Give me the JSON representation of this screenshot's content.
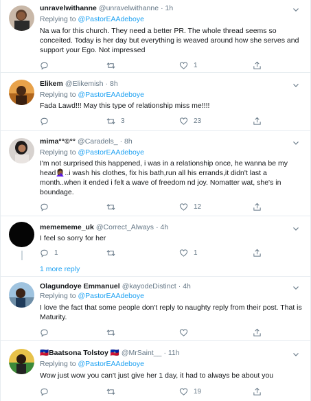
{
  "reply_prefix": "Replying to ",
  "tweets": [
    {
      "name": "unravelwithanne",
      "handle": "@unravelwithanne",
      "time": "· 1h",
      "replying_to": "@PastorEAAdeboye",
      "text": "Na wa for this church. They need a better PR. The whole thread seems so conceited. Today is her day but everything is weaved around how she serves and support your Ego. Not impressed",
      "replies": "",
      "retweets": "",
      "likes": "1"
    },
    {
      "name": "Elikem",
      "handle": "@Elikemish",
      "time": "· 8h",
      "replying_to": "@PastorEAAdeboye",
      "text": "Fada Lawd!!! May this type of relationship miss me!!!!",
      "replies": "",
      "retweets": "3",
      "likes": "23"
    },
    {
      "name": "mima°°©°°",
      "handle": "@Caradels_",
      "time": "· 8h",
      "replying_to": "@PastorEAAdeboye",
      "text": "I'm not surprised this happened, i was in a relationship once, he wanna be my head🤦🏾‍♀️..i wash his clothes, fix his bath,run all his errands,it didn't last a month..when it ended i felt a wave of freedom nd joy. Nomatter wat, she's in boundage.",
      "replies": "",
      "retweets": "",
      "likes": "12"
    },
    {
      "name": "memememe_uk",
      "handle": "@Correct_Always",
      "time": "· 4h",
      "replying_to": "",
      "text": "I feel so sorry for her",
      "replies": "1",
      "retweets": "",
      "likes": "1"
    },
    {
      "name": "Olagundoye Emmanuel",
      "handle": "@kayodeDistinct",
      "time": "· 4h",
      "replying_to": "@PastorEAAdeboye",
      "text": "I love the fact that some people don't reply to naughty reply from their post. That is Maturity.",
      "replies": "",
      "retweets": "",
      "likes": ""
    },
    {
      "name": "🇭🇹Baatsona Tolstoy 🇭🇹",
      "handle": "@MrSaint__",
      "time": "· 11h",
      "replying_to": "@PastorEAAdeboye",
      "text": "Wow just wow you can't just give her 1 day, it had to always be about you",
      "replies": "",
      "retweets": "",
      "likes": "19"
    }
  ],
  "more_replies_label": "1 more reply",
  "icons": {
    "reply": "reply-icon",
    "retweet": "retweet-icon",
    "like": "heart-icon",
    "share": "share-icon",
    "more": "chevron-down-icon"
  },
  "colors": {
    "link": "#1da1f2",
    "muted": "#657786",
    "divider": "#e6ecf0"
  }
}
